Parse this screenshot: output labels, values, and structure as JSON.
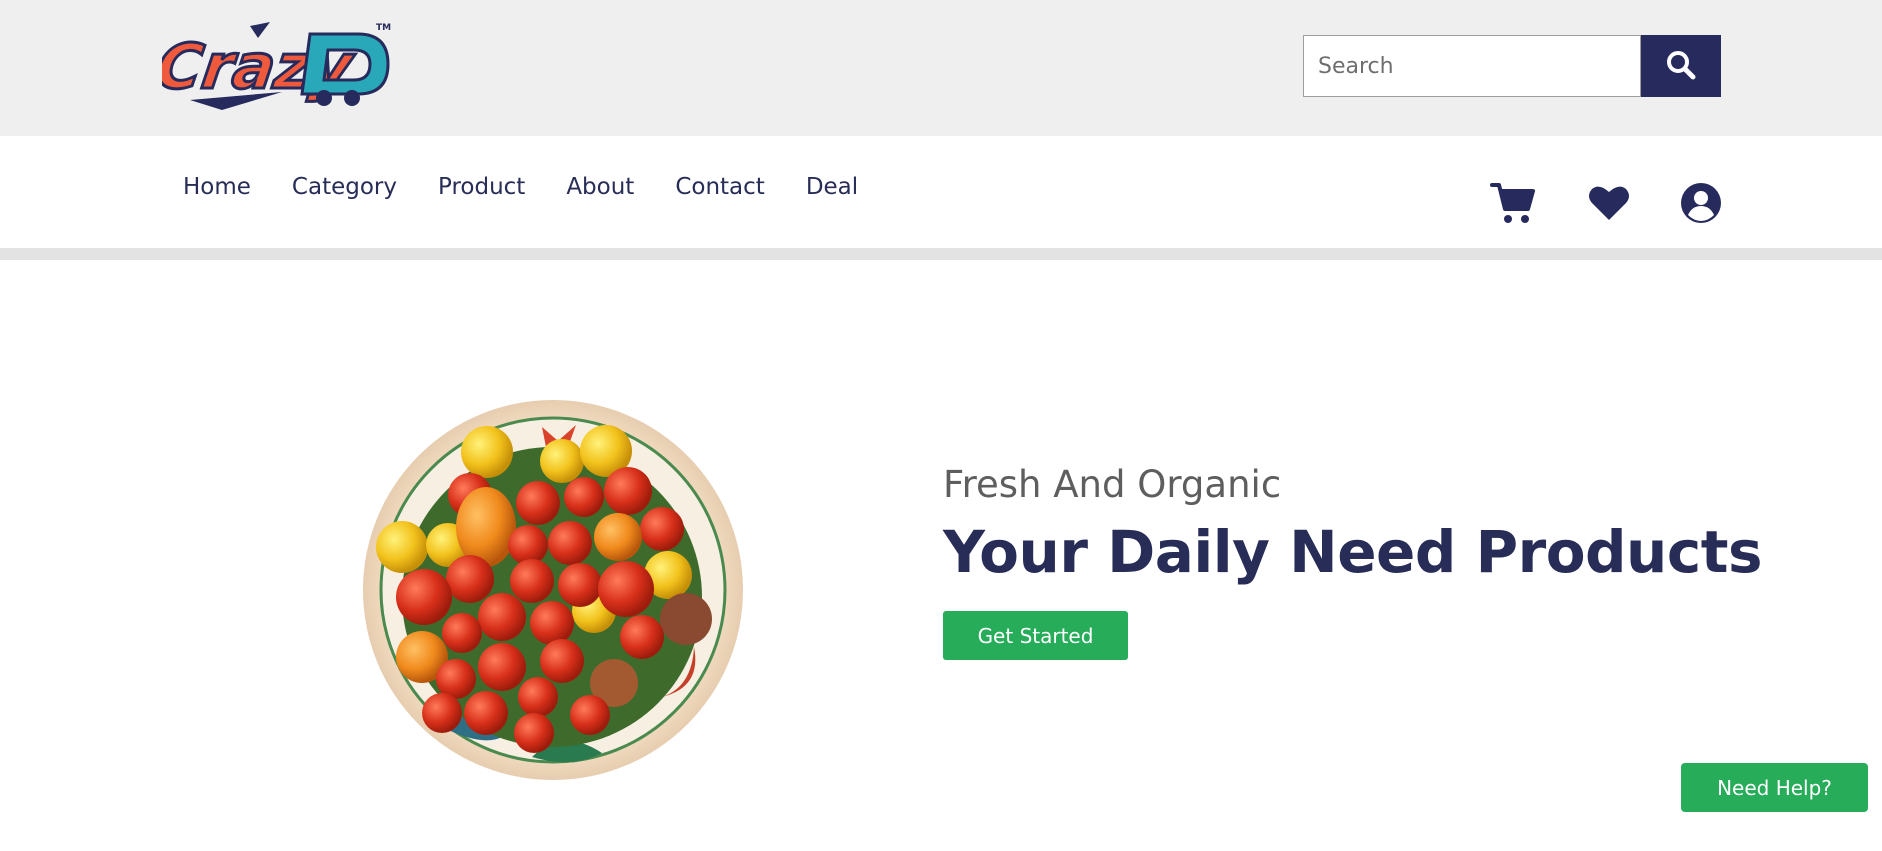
{
  "brand": {
    "logo_text": "CrazyD",
    "logo_trademark": "TM",
    "logo_colors": {
      "primary": "#ef5a3c",
      "secondary": "#29a8b9",
      "outline": "#262a5c"
    }
  },
  "search": {
    "placeholder": "Search",
    "value": "",
    "button_icon": "search-icon"
  },
  "nav": {
    "items": [
      {
        "label": "Home"
      },
      {
        "label": "Category"
      },
      {
        "label": "Product"
      },
      {
        "label": "About"
      },
      {
        "label": "Contact"
      },
      {
        "label": "Deal"
      }
    ],
    "icons": [
      "cart-icon",
      "heart-icon",
      "user-icon"
    ]
  },
  "hero": {
    "image": "bowl-of-cherry-tomatoes",
    "subtitle": "Fresh And Organic",
    "title": "Your Daily Need Products",
    "cta_label": "Get Started"
  },
  "help_button": {
    "label": "Need Help?"
  },
  "colors": {
    "navy": "#262a5c",
    "green": "#27ac5a",
    "topbar_bg": "#efefef"
  }
}
